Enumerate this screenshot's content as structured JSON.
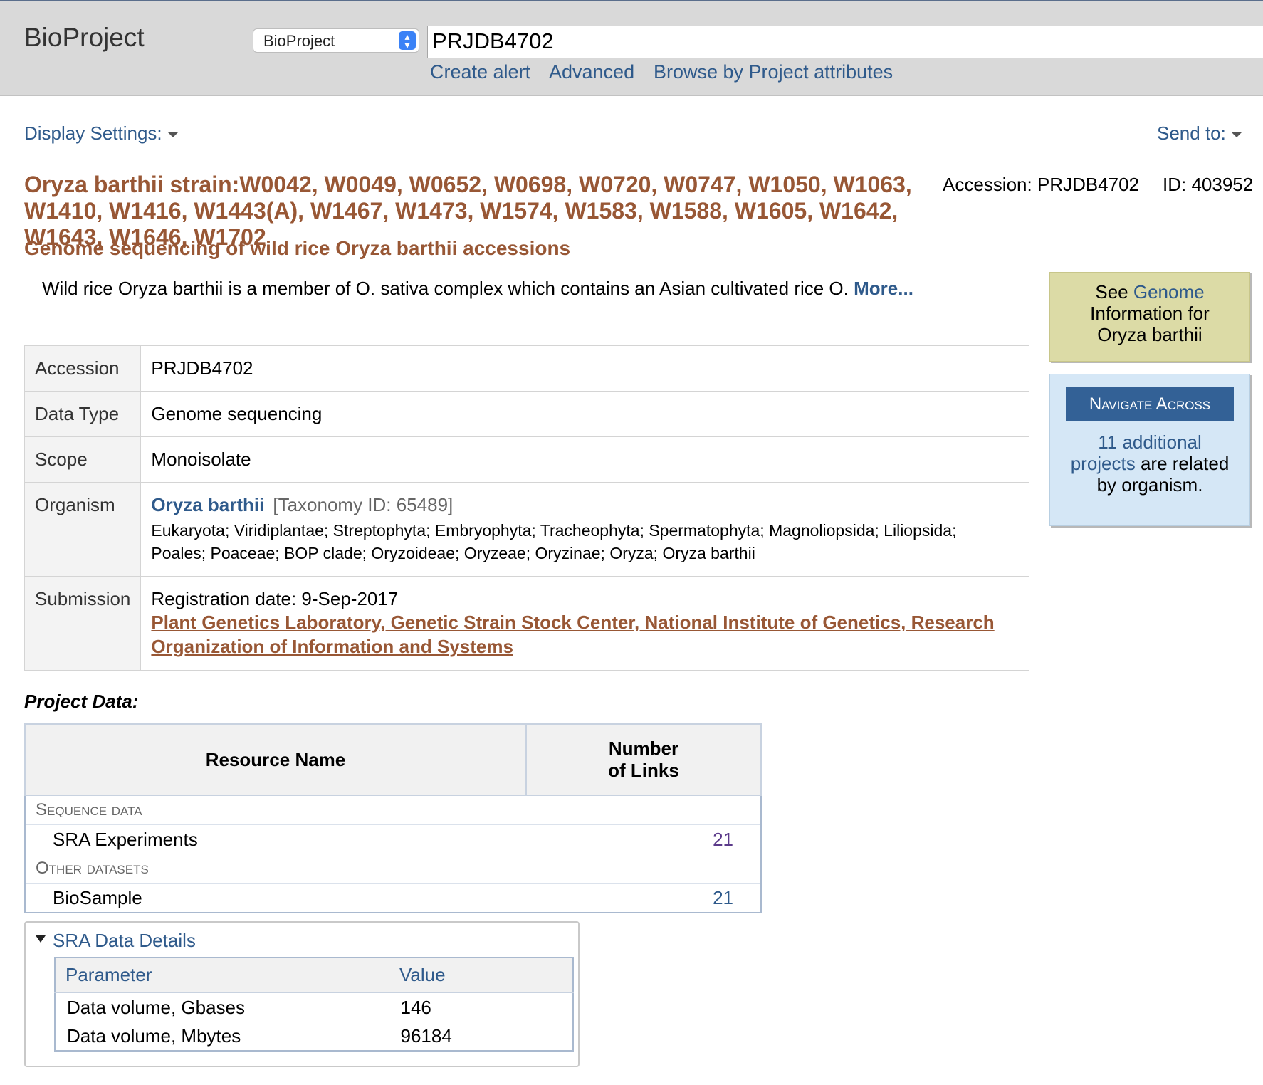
{
  "header": {
    "app_title": "BioProject",
    "db_select_value": "BioProject",
    "search_value": "PRJDB4702",
    "links": [
      "Create alert",
      "Advanced",
      "Browse by Project attributes"
    ]
  },
  "toolbar": {
    "display_settings": "Display Settings:",
    "send_to": "Send to:"
  },
  "record": {
    "title_line1": "Oryza barthii strain:W0042, W0049, W0652, W0698, W0720, W0747, W1050, W1063,",
    "title_line2": "W1410, W1416, W1443(A), W1467, W1473, W1574, W1583, W1588, W1605, W1642, W1643, W1646, W1702",
    "accession_header": "Accession: PRJDB4702",
    "id_header": "ID: 403952",
    "subtitle": "Genome sequencing of wild rice Oryza barthii accessions",
    "description": "Wild rice Oryza barthii is a member of O. sativa complex which contains an Asian cultivated rice O.",
    "more_link": "More..."
  },
  "sidebar": {
    "genome_box": {
      "prefix": "See ",
      "link": "Genome",
      "line2": "Information for",
      "line3": "Oryza barthii"
    },
    "navigate": {
      "header": "Navigate Across",
      "link_part1": "11 additional",
      "link_part2": "projects",
      "text_part2": " are related",
      "text_line3": "by organism."
    }
  },
  "info_table": {
    "accession_label": "Accession",
    "accession_value": "PRJDB4702",
    "datatype_label": "Data Type",
    "datatype_value": "Genome sequencing",
    "scope_label": "Scope",
    "scope_value": "Monoisolate",
    "organism_label": "Organism",
    "organism_name": "Oryza barthii",
    "taxonomy": "[Taxonomy ID: 65489]",
    "lineage_line1": "Eukaryota; Viridiplantae; Streptophyta; Embryophyta; Tracheophyta; Spermatophyta; Magnoliopsida; Liliopsida;",
    "lineage_line2": "Poales; Poaceae; BOP clade; Oryzoideae; Oryzeae; Oryzinae; Oryza; Oryza barthii",
    "submission_label": "Submission",
    "registration": "Registration date: 9-Sep-2017",
    "submitter_line1": "Plant Genetics Laboratory, Genetic Strain Stock Center, National Institute of Genetics, Research",
    "submitter_line2": "Organization of Information and Systems"
  },
  "project_data": {
    "label": "Project Data:",
    "col_resource": "Resource Name",
    "col_links_line1": "Number",
    "col_links_line2": "of Links",
    "cat1": "Sequence data",
    "row1_name": "SRA Experiments",
    "row1_count": "21",
    "cat2": "Other datasets",
    "row2_name": "BioSample",
    "row2_count": "21"
  },
  "sra_details": {
    "toggle": "SRA Data Details",
    "col_param": "Parameter",
    "col_value": "Value",
    "rows": [
      {
        "param": "Data volume, Gbases",
        "value": "146"
      },
      {
        "param": "Data volume, Mbytes",
        "value": "96184"
      }
    ]
  }
}
